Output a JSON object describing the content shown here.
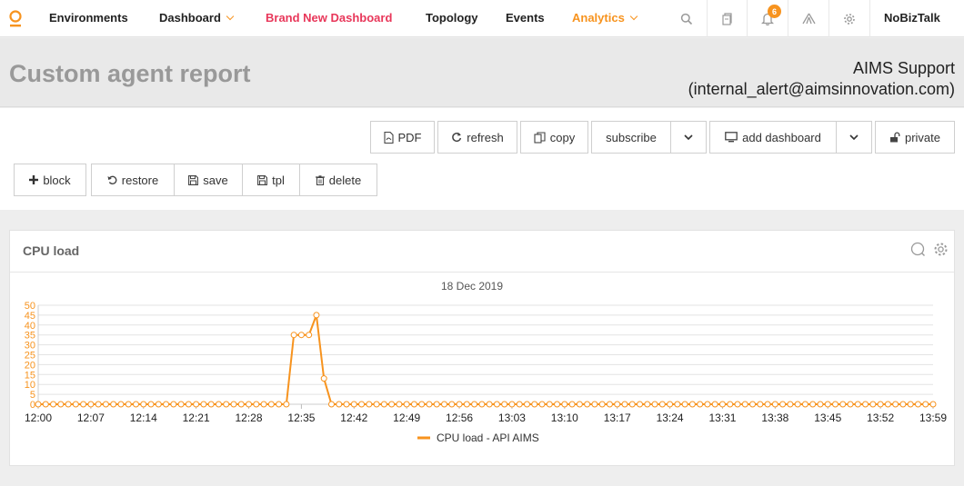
{
  "nav": {
    "items": [
      {
        "label": "Environments",
        "dropdown": false,
        "color": "#222222"
      },
      {
        "label": "Dashboard",
        "dropdown": true,
        "color": "#222222"
      },
      {
        "label": "Brand New Dashboard",
        "dropdown": false,
        "color": "#e8375a"
      },
      {
        "label": "Topology",
        "dropdown": false,
        "color": "#222222"
      },
      {
        "label": "Events",
        "dropdown": false,
        "color": "#222222"
      },
      {
        "label": "Analytics",
        "dropdown": true,
        "color": "#f7931e"
      }
    ],
    "icons": [
      "search-icon",
      "book-icon",
      "bell-icon",
      "tent-icon",
      "gear-icon"
    ],
    "notification_count": "6",
    "user_label": "NoBizTalk"
  },
  "header": {
    "title": "Custom agent report",
    "support_name": "AIMS Support",
    "support_email": "(internal_alert@aimsinnovation.com)"
  },
  "toolbar": {
    "pdf": "PDF",
    "refresh": "refresh",
    "copy": "copy",
    "subscribe": "subscribe",
    "add_dashboard": "add dashboard",
    "private": "private"
  },
  "blocks": {
    "block": "block",
    "restore": "restore",
    "save": "save",
    "tpl": "tpl",
    "delete": "delete"
  },
  "widget": {
    "title": "CPU load",
    "icons": [
      "search-icon",
      "gear-icon"
    ]
  },
  "colors": {
    "accent": "#f7931e",
    "brand": "#e8375a"
  },
  "chart_data": {
    "type": "line",
    "title": "18 Dec 2019",
    "xlabel": "",
    "ylabel": "",
    "x": [
      "12:00",
      "12:01",
      "12:02",
      "12:03",
      "12:04",
      "12:05",
      "12:06",
      "12:07",
      "12:08",
      "12:09",
      "12:10",
      "12:11",
      "12:12",
      "12:13",
      "12:14",
      "12:15",
      "12:16",
      "12:17",
      "12:18",
      "12:19",
      "12:20",
      "12:21",
      "12:22",
      "12:23",
      "12:24",
      "12:25",
      "12:26",
      "12:27",
      "12:28",
      "12:29",
      "12:30",
      "12:31",
      "12:32",
      "12:33",
      "12:34",
      "12:35",
      "12:36",
      "12:37",
      "12:38",
      "12:39",
      "12:40",
      "12:41",
      "12:42",
      "12:43",
      "12:44",
      "12:45",
      "12:46",
      "12:47",
      "12:48",
      "12:49",
      "12:50",
      "12:51",
      "12:52",
      "12:53",
      "12:54",
      "12:55",
      "12:56",
      "12:57",
      "12:58",
      "12:59",
      "13:00",
      "13:01",
      "13:02",
      "13:03",
      "13:04",
      "13:05",
      "13:06",
      "13:07",
      "13:08",
      "13:09",
      "13:10",
      "13:11",
      "13:12",
      "13:13",
      "13:14",
      "13:15",
      "13:16",
      "13:17",
      "13:18",
      "13:19",
      "13:20",
      "13:21",
      "13:22",
      "13:23",
      "13:24",
      "13:25",
      "13:26",
      "13:27",
      "13:28",
      "13:29",
      "13:30",
      "13:31",
      "13:32",
      "13:33",
      "13:34",
      "13:35",
      "13:36",
      "13:37",
      "13:38",
      "13:39",
      "13:40",
      "13:41",
      "13:42",
      "13:43",
      "13:44",
      "13:45",
      "13:46",
      "13:47",
      "13:48",
      "13:49",
      "13:50",
      "13:51",
      "13:52",
      "13:53",
      "13:54",
      "13:55",
      "13:56",
      "13:57",
      "13:58",
      "13:59"
    ],
    "series": [
      {
        "name": "CPU load - API AIMS",
        "color": "#f7931e",
        "values": [
          0,
          0,
          0,
          0,
          0,
          0,
          0,
          0,
          0,
          0,
          0,
          0,
          0,
          0,
          0,
          0,
          0,
          0,
          0,
          0,
          0,
          0,
          0,
          0,
          0,
          0,
          0,
          0,
          0,
          0,
          0,
          0,
          0,
          0,
          35,
          35,
          35,
          45,
          13,
          0,
          0,
          0,
          0,
          0,
          0,
          0,
          0,
          0,
          0,
          0,
          0,
          0,
          0,
          0,
          0,
          0,
          0,
          0,
          0,
          0,
          0,
          0,
          0,
          0,
          0,
          0,
          0,
          0,
          0,
          0,
          0,
          0,
          0,
          0,
          0,
          0,
          0,
          0,
          0,
          0,
          0,
          0,
          0,
          0,
          0,
          0,
          0,
          0,
          0,
          0,
          0,
          0,
          0,
          0,
          0,
          0,
          0,
          0,
          0,
          0,
          0,
          0,
          0,
          0,
          0,
          0,
          0,
          0,
          0,
          0,
          0,
          0,
          0,
          0,
          0,
          0,
          0,
          0,
          0,
          0
        ]
      }
    ],
    "markers_drawn_at_index_step": 1,
    "x_ticks": [
      "12:00",
      "12:07",
      "12:14",
      "12:21",
      "12:28",
      "12:35",
      "12:42",
      "12:49",
      "12:56",
      "13:03",
      "13:10",
      "13:17",
      "13:24",
      "13:31",
      "13:38",
      "13:45",
      "13:52",
      "13:59"
    ],
    "y_ticks": [
      0,
      5,
      10,
      15,
      20,
      25,
      30,
      35,
      40,
      45,
      50
    ],
    "ylim": [
      0,
      50
    ],
    "grid": true,
    "legend_placement": "bottom"
  }
}
